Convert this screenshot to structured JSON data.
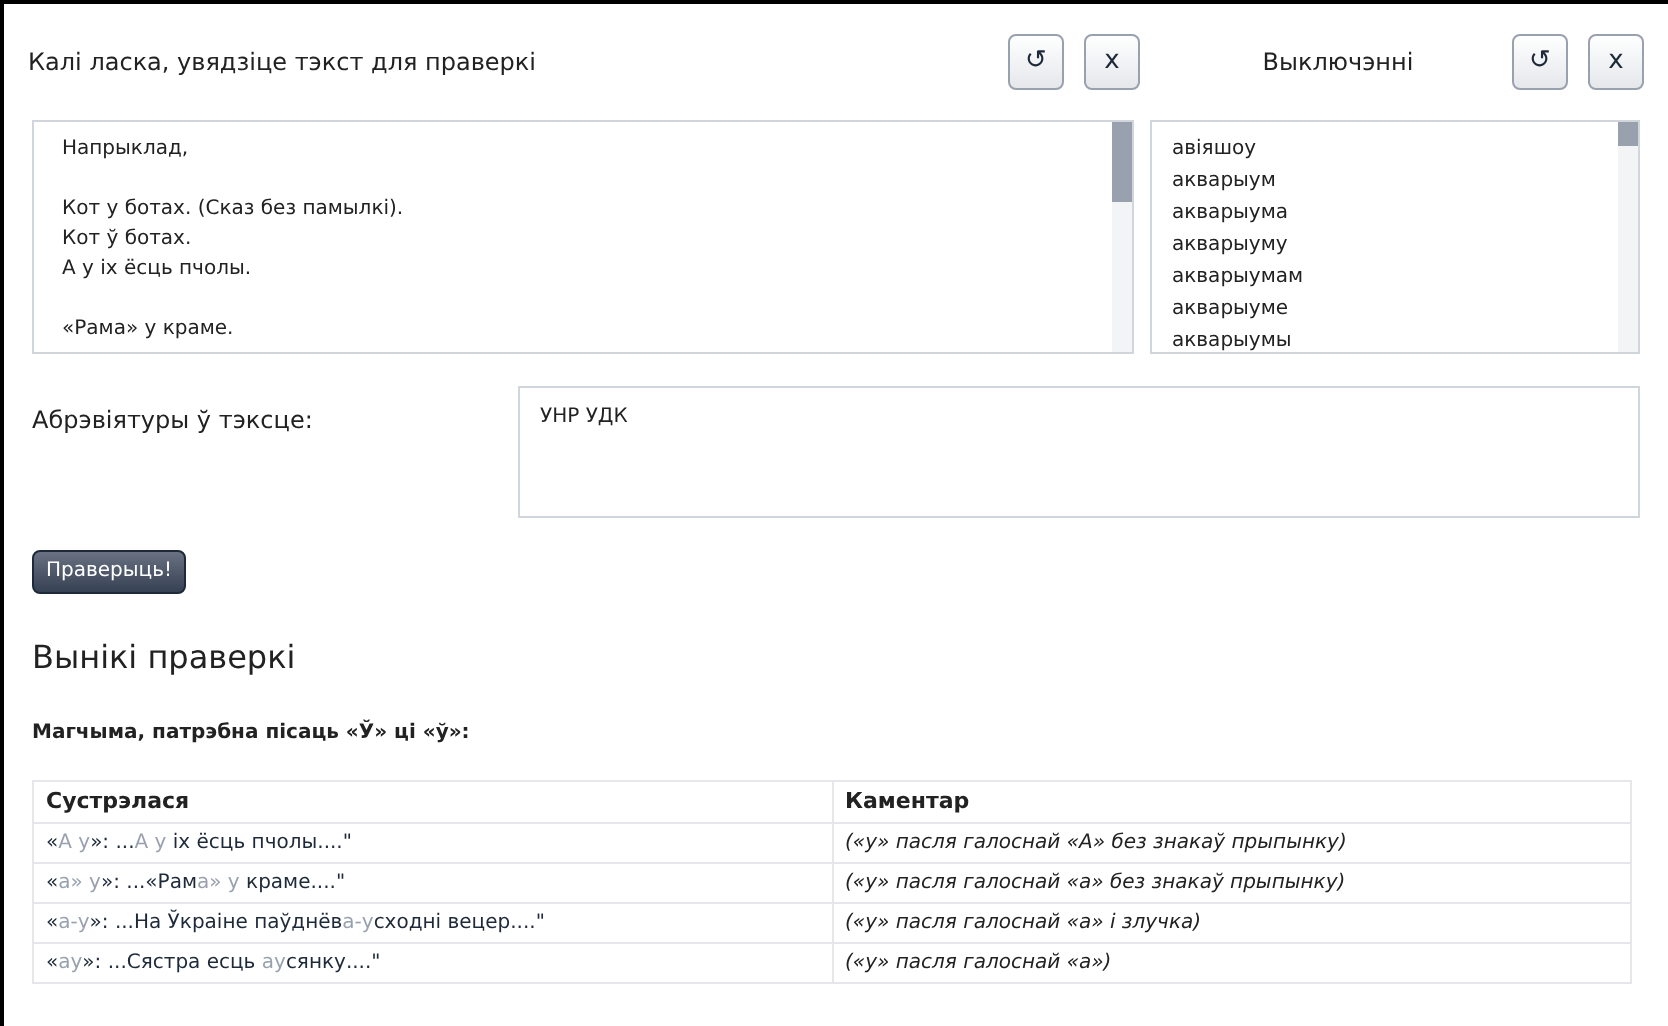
{
  "input_panel": {
    "title": "Калі ласка, увядзіце тэкст для праверкі",
    "reset_button": "↺",
    "clear_button": "x",
    "paragraphs": [
      [
        "Напрыклад,"
      ],
      [
        "Кот у ботах. (Сказ без памылкі).",
        "Кот ў ботах.",
        "А у іх ёсць пчолы."
      ],
      [
        "«Рама» у краме."
      ]
    ]
  },
  "exclusions_panel": {
    "title": "Выключэнні",
    "reset_button": "↺",
    "clear_button": "x",
    "lines": [
      "авіяшоу",
      "акварыум",
      "акварыума",
      "акварыуму",
      "акварыумам",
      "акварыуме",
      "акварыумы"
    ]
  },
  "abbreviations": {
    "label": "Абрэвіятуры ў тэксце:",
    "value": "УНР УДК"
  },
  "check_button": "Праверыць!",
  "results": {
    "title": "Вынікі праверкі",
    "subtitle": "Магчыма, патрэбна пісаць «Ў» ці «ў»:",
    "columns": [
      "Сустрэлася",
      "Каментар"
    ],
    "rows": [
      {
        "found": [
          {
            "text": "«",
            "hl": false
          },
          {
            "text": "А у",
            "hl": true
          },
          {
            "text": "»: ...",
            "hl": false
          },
          {
            "text": "А у",
            "hl": true
          },
          {
            "text": " іх ёсць пчолы....\"",
            "hl": false
          }
        ],
        "comment": "(«у» пасля галоснай «А» без знакаў прыпынку)"
      },
      {
        "found": [
          {
            "text": "«",
            "hl": false
          },
          {
            "text": "а» у",
            "hl": true
          },
          {
            "text": "»: ...«Рам",
            "hl": false
          },
          {
            "text": "а» у",
            "hl": true
          },
          {
            "text": " краме....\"",
            "hl": false
          }
        ],
        "comment": "(«у» пасля галоснай «а» без знакаў прыпынку)"
      },
      {
        "found": [
          {
            "text": "«",
            "hl": false
          },
          {
            "text": "а-у",
            "hl": true
          },
          {
            "text": "»: ...На Ўкраіне паўднёв",
            "hl": false
          },
          {
            "text": "а-у",
            "hl": true
          },
          {
            "text": "сходні вецер....\"",
            "hl": false
          }
        ],
        "comment": "(«у» пасля галоснай «а» і злучка)"
      },
      {
        "found": [
          {
            "text": "«",
            "hl": false
          },
          {
            "text": "ау",
            "hl": true
          },
          {
            "text": "»: ...Сястра есць ",
            "hl": false
          },
          {
            "text": "ау",
            "hl": true
          },
          {
            "text": "сянку....\"",
            "hl": false
          }
        ],
        "comment": "(«у» пасля галоснай «а»)"
      }
    ]
  }
}
